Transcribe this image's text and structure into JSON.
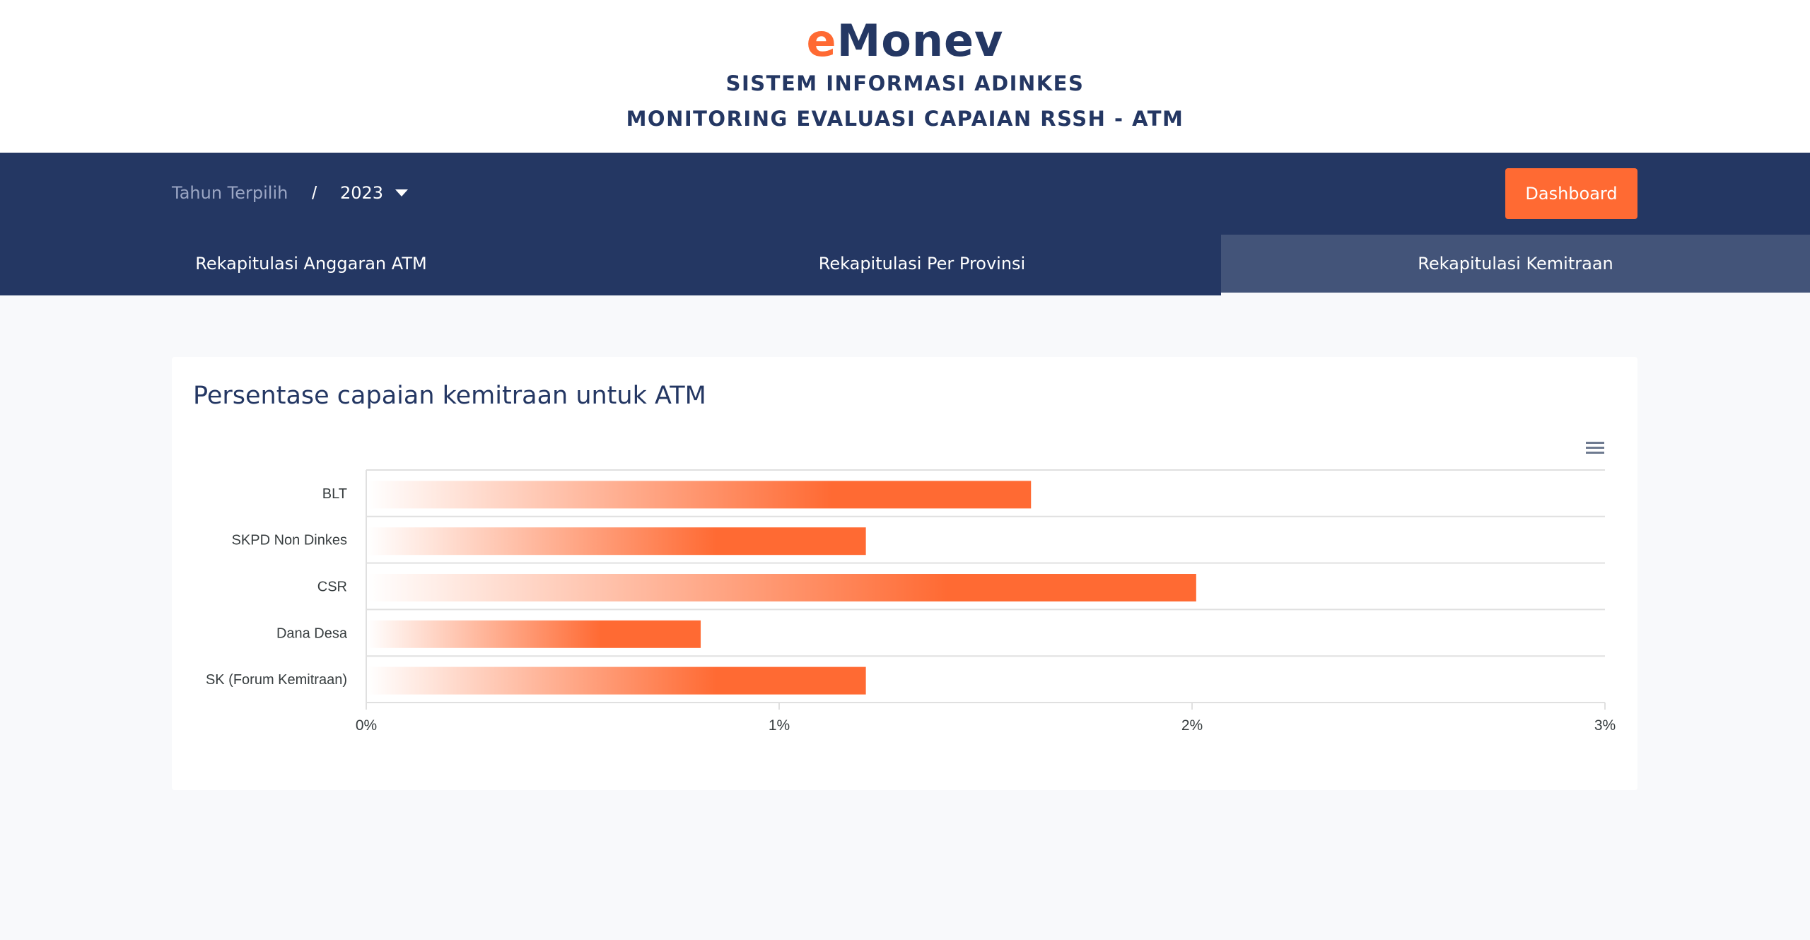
{
  "header": {
    "logo_e": "e",
    "logo_rest": "Monev",
    "subtitle_1": "SISTEM INFORMASI ADINKES",
    "subtitle_2": "MONITORING EVALUASI CAPAIAN RSSH - ATM"
  },
  "topbar": {
    "year_label": "Tahun Terpilih",
    "separator": "/",
    "year_value": "2023",
    "dashboard_label": "Dashboard"
  },
  "tabs": [
    {
      "label": "Rekapitulasi Anggaran ATM",
      "active": false
    },
    {
      "label": "Rekapitulasi Per Provinsi",
      "active": false
    },
    {
      "label": "Rekapitulasi Kemitraan",
      "active": true
    }
  ],
  "card": {
    "title": "Persentase capaian kemitraan untuk ATM",
    "menu_icon": "hamburger-menu-icon"
  },
  "colors": {
    "navy": "#243763",
    "accent": "#ff6a33",
    "active_tab": "#435479"
  },
  "chart_data": {
    "type": "bar",
    "orientation": "horizontal",
    "categories": [
      "BLT",
      "SKPD Non Dinkes",
      "CSR",
      "Dana Desa",
      "SK (Forum Kemitraan)"
    ],
    "values": [
      1.61,
      1.21,
      2.01,
      0.81,
      1.21
    ],
    "xlim": [
      0,
      3
    ],
    "x_ticks": [
      "0%",
      "1%",
      "2%",
      "3%"
    ],
    "unit": "%",
    "bar_color": "#ff6a33",
    "grid": true,
    "legend": false
  }
}
